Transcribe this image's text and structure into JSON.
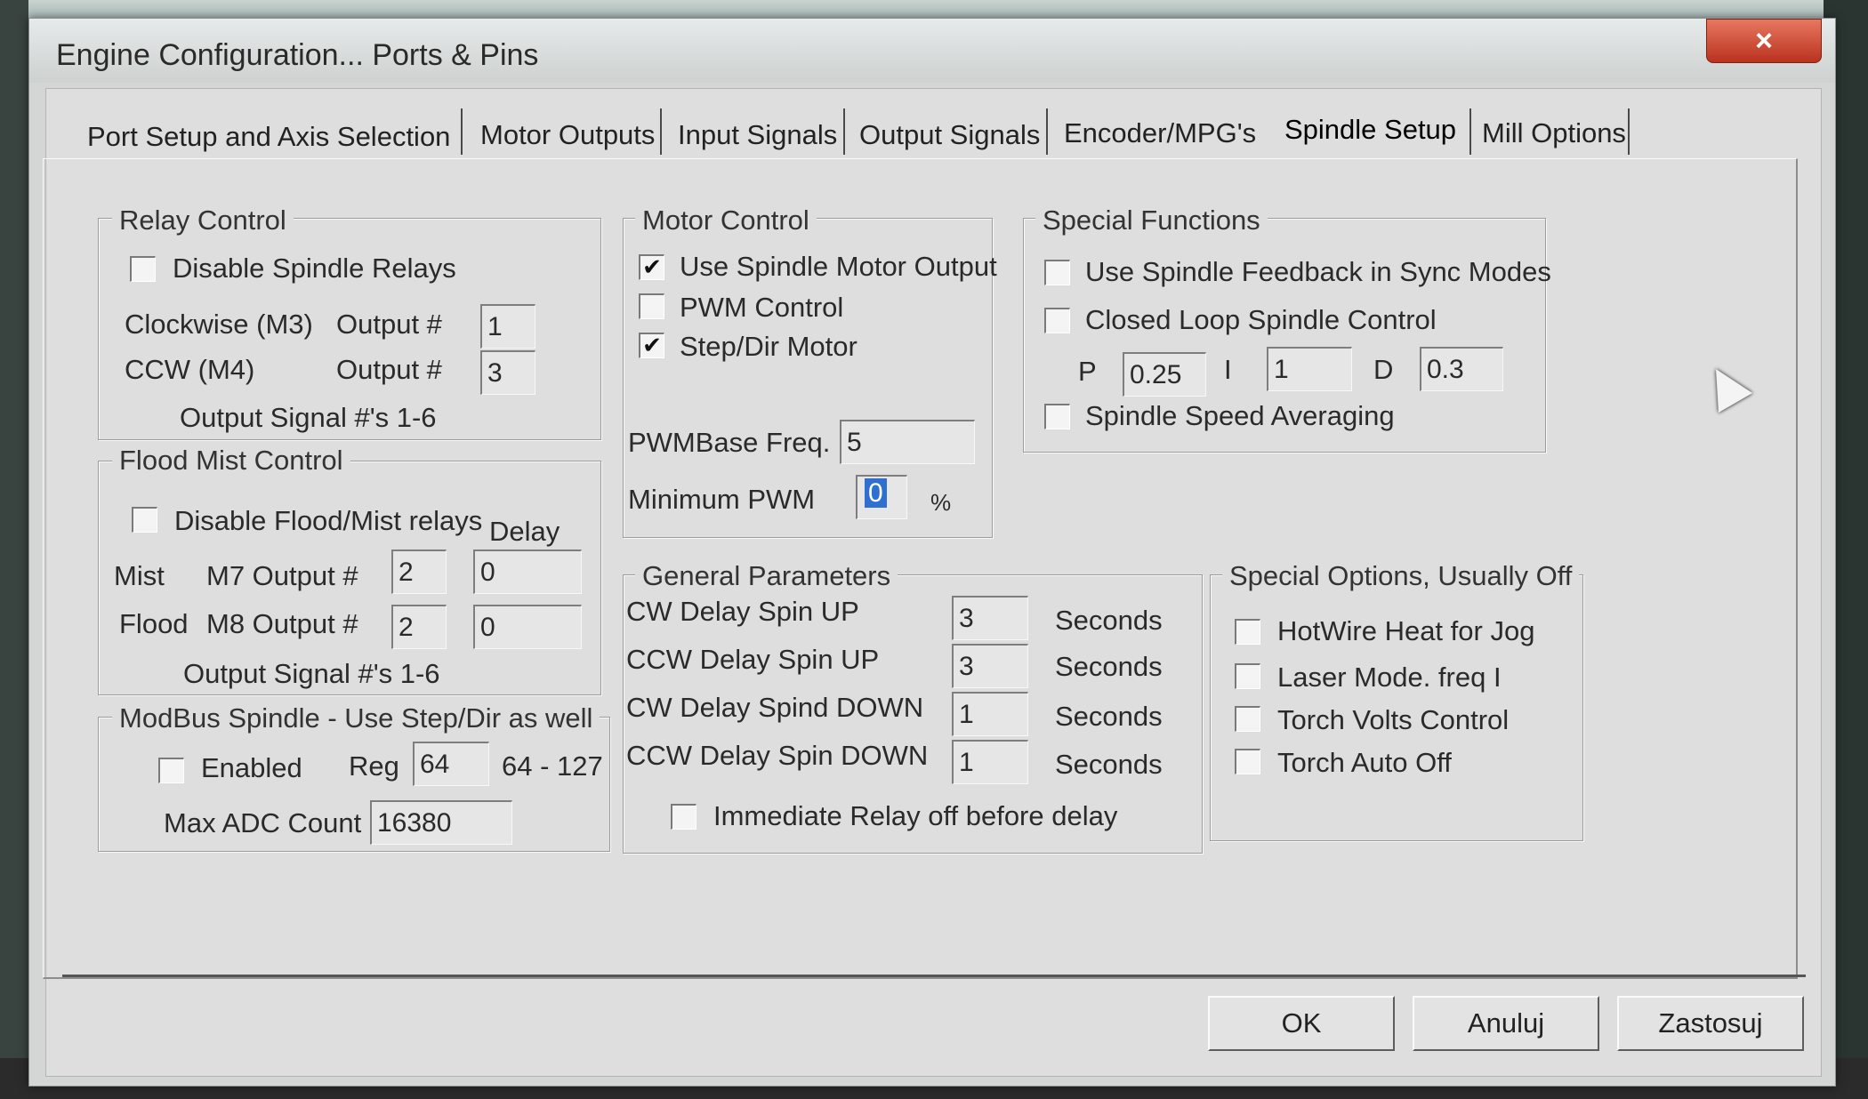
{
  "window": {
    "title": "Engine Configuration... Ports & Pins",
    "close_icon": "×"
  },
  "tabs": [
    {
      "label": "Port Setup and Axis Selection"
    },
    {
      "label": "Motor Outputs"
    },
    {
      "label": "Input Signals"
    },
    {
      "label": "Output Signals"
    },
    {
      "label": "Encoder/MPG's"
    },
    {
      "label": "Spindle Setup",
      "active": true
    },
    {
      "label": "Mill Options"
    }
  ],
  "relay_control": {
    "legend": "Relay Control",
    "disable_label": "Disable Spindle Relays",
    "disable_checked": false,
    "cw_label": "Clockwise (M3)",
    "ccw_label": "CCW (M4)",
    "output_label": "Output #",
    "cw_output": "1",
    "ccw_output": "3",
    "footer": "Output Signal #'s 1-6"
  },
  "flood_mist": {
    "legend": "Flood Mist Control",
    "disable_label": "Disable Flood/Mist relays",
    "disable_checked": false,
    "delay_label": "Delay",
    "mist_label": "Mist",
    "mist_output_label": "M7 Output #",
    "mist_output": "2",
    "mist_delay": "0",
    "flood_label": "Flood",
    "flood_output_label": "M8 Output #",
    "flood_output": "2",
    "flood_delay": "0",
    "footer": "Output Signal #'s 1-6"
  },
  "modbus": {
    "legend": "ModBus Spindle - Use Step/Dir as well",
    "enabled_label": "Enabled",
    "enabled_checked": false,
    "reg_label": "Reg",
    "reg_value": "64",
    "reg_range": "64 - 127",
    "max_adc_label": "Max ADC Count",
    "max_adc_value": "16380"
  },
  "motor_control": {
    "legend": "Motor Control",
    "use_spindle_label": "Use Spindle Motor Output",
    "use_spindle_checked": true,
    "pwm_label": "PWM Control",
    "pwm_checked": false,
    "stepdir_label": "Step/Dir Motor",
    "stepdir_checked": true,
    "pwm_base_label": "PWMBase Freq.",
    "pwm_base_value": "5",
    "min_pwm_label": "Minimum PWM",
    "min_pwm_value": "0",
    "percent": "%"
  },
  "special_functions": {
    "legend": "Special Functions",
    "feedback_label": "Use Spindle Feedback in Sync Modes",
    "feedback_checked": false,
    "closed_loop_label": "Closed Loop Spindle Control",
    "closed_loop_checked": false,
    "p_label": "P",
    "p_value": "0.25",
    "i_label": "I",
    "i_value": "1",
    "d_label": "D",
    "d_value": "0.3",
    "averaging_label": "Spindle Speed Averaging",
    "averaging_checked": false
  },
  "general_parameters": {
    "legend": "General Parameters",
    "seconds": "Seconds",
    "rows": [
      {
        "label": "CW Delay Spin UP",
        "value": "3"
      },
      {
        "label": "CCW Delay Spin UP",
        "value": "3"
      },
      {
        "label": "CW Delay Spind DOWN",
        "value": "1"
      },
      {
        "label": "CCW Delay Spin DOWN",
        "value": "1"
      }
    ],
    "immediate_label": "Immediate Relay off before delay",
    "immediate_checked": false
  },
  "special_options": {
    "legend": "Special Options, Usually Off",
    "items": [
      {
        "label": "HotWire Heat for Jog",
        "checked": false
      },
      {
        "label": "Laser Mode. freq I",
        "checked": false
      },
      {
        "label": "Torch Volts Control",
        "checked": false
      },
      {
        "label": "Torch Auto Off",
        "checked": false
      }
    ]
  },
  "buttons": {
    "ok": "OK",
    "cancel": "Anuluj",
    "apply": "Zastosuj"
  },
  "check_glyph": "✔"
}
